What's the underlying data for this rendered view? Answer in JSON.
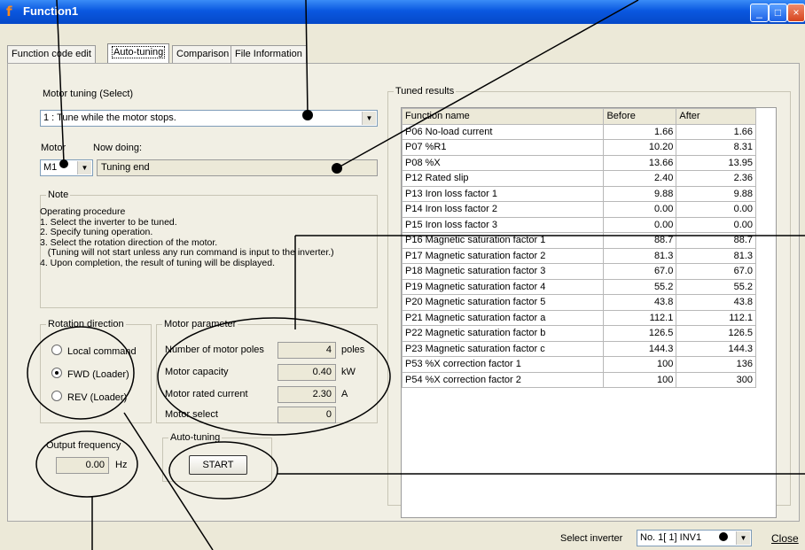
{
  "window": {
    "title": "Function1",
    "app_icon": "f-icon"
  },
  "tabs": [
    "Function code edit",
    "Auto-tuning",
    "Comparison",
    "File Information"
  ],
  "active_tab": "Auto-tuning",
  "motor_tuning": {
    "label": "Motor tuning (Select)",
    "value": "1 : Tune while the motor stops."
  },
  "motor": {
    "label": "Motor",
    "value": "M1"
  },
  "now_doing": {
    "label": "Now doing:",
    "value": "Tuning end"
  },
  "note": {
    "title": "Note",
    "lines": [
      "Operating procedure",
      "1. Select the inverter to be tuned.",
      "2. Specify tuning operation.",
      "3. Select the rotation direction of the motor.",
      "   (Tuning will not start unless any run command is input to the inverter.)",
      "4. Upon completion, the result of tuning will be displayed."
    ]
  },
  "rotation": {
    "title": "Rotation direction",
    "options": [
      "Local command",
      "FWD (Loader)",
      "REV (Loader)"
    ],
    "selected": "FWD (Loader)"
  },
  "motor_param": {
    "title": "Motor parameter",
    "rows": [
      {
        "label": "Number of motor poles",
        "value": "4",
        "unit": "poles"
      },
      {
        "label": "Motor capacity",
        "value": "0.40",
        "unit": "kW"
      },
      {
        "label": "Motor rated current",
        "value": "2.30",
        "unit": "A"
      },
      {
        "label": "Motor select",
        "value": "0",
        "unit": ""
      }
    ]
  },
  "output_frequency": {
    "title": "Output frequency",
    "value": "0.00",
    "unit": "Hz"
  },
  "auto_tuning": {
    "title": "Auto-tuning",
    "start_label": "START"
  },
  "tuned_results": {
    "title": "Tuned results",
    "columns": [
      "Function name",
      "Before",
      "After"
    ],
    "rows": [
      [
        "P06 No-load current",
        "1.66",
        "1.66"
      ],
      [
        "P07 %R1",
        "10.20",
        "8.31"
      ],
      [
        "P08 %X",
        "13.66",
        "13.95"
      ],
      [
        "P12 Rated slip",
        "2.40",
        "2.36"
      ],
      [
        "P13 Iron loss factor 1",
        "9.88",
        "9.88"
      ],
      [
        "P14 Iron loss factor 2",
        "0.00",
        "0.00"
      ],
      [
        "P15 Iron loss factor 3",
        "0.00",
        "0.00"
      ],
      [
        "P16 Magnetic saturation factor 1",
        "88.7",
        "88.7"
      ],
      [
        "P17 Magnetic saturation factor 2",
        "81.3",
        "81.3"
      ],
      [
        "P18 Magnetic saturation factor 3",
        "67.0",
        "67.0"
      ],
      [
        "P19 Magnetic saturation factor 4",
        "55.2",
        "55.2"
      ],
      [
        "P20 Magnetic saturation factor 5",
        "43.8",
        "43.8"
      ],
      [
        "P21 Magnetic saturation factor a",
        "112.1",
        "112.1"
      ],
      [
        "P22 Magnetic saturation factor b",
        "126.5",
        "126.5"
      ],
      [
        "P23 Magnetic saturation factor c",
        "144.3",
        "144.3"
      ],
      [
        "P53 %X correction factor 1",
        "100",
        "136"
      ],
      [
        "P54 %X correction factor 2",
        "100",
        "300"
      ]
    ]
  },
  "select_inverter": {
    "label": "Select inverter",
    "value": "No. 1[ 1] INV1"
  },
  "close_label": "Close"
}
